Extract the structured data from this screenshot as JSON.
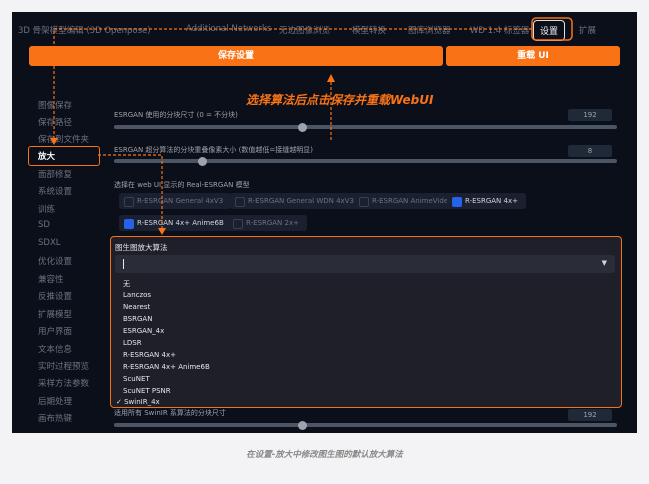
{
  "tabs": [
    "3D 骨架模型编辑 (3D Openpose)",
    "Additional Networks",
    "无边图像浏览",
    "模型转换",
    "图库浏览器",
    "WD 1.4 标签器",
    "设置",
    "扩展"
  ],
  "active_tab": "设置",
  "buttons": {
    "save": "保存设置",
    "reload": "重载 UI"
  },
  "sidebar": [
    "图像保存",
    "保存路径",
    "保存到文件夹",
    "放大",
    "面部修复",
    "系统设置",
    "训练",
    "SD",
    "SDXL",
    "优化设置",
    "兼容性",
    "反推设置",
    "扩展模型",
    "用户界面",
    "文本信息",
    "实时过程预览",
    "采样方法参数",
    "后期处理",
    "画布热键"
  ],
  "sidebar_active": "放大",
  "settings": {
    "esrgan_tile_label": "ESRGAN 使用的分块尺寸 (0 = 不分块)",
    "esrgan_tile_value": "192",
    "esrgan_overlap_label": "ESRGAN 超分算法的分块重叠像素大小 (数值越低=接缝越明显)",
    "esrgan_overlap_value": "8",
    "realesrgan_label": "选择在 web UI 显示的 Real-ESRGAN 模型",
    "realesrgan_models": [
      {
        "label": "R-ESRGAN General 4xV3",
        "checked": false
      },
      {
        "label": "R-ESRGAN General WDN 4xV3",
        "checked": false
      },
      {
        "label": "R-ESRGAN AnimeVideo",
        "checked": false
      },
      {
        "label": "R-ESRGAN 4x+",
        "checked": true
      },
      {
        "label": "R-ESRGAN 4x+ Anime6B",
        "checked": true
      },
      {
        "label": "R-ESRGAN 2x+",
        "checked": false
      }
    ],
    "swinir_tile_label": "适用所有 SwinIR 系算法的分块尺寸",
    "swinir_tile_value": "192"
  },
  "dropdown": {
    "title": "图生图放大算法",
    "options": [
      "无",
      "Lanczos",
      "Nearest",
      "BSRGAN",
      "ESRGAN_4x",
      "LDSR",
      "R-ESRGAN 4x+",
      "R-ESRGAN 4x+ Anime6B",
      "ScuNET",
      "ScuNET PSNR",
      "SwinIR_4x"
    ],
    "selected": "SwinIR_4x",
    "check_mark": "✓"
  },
  "annotation": "选择算法后点击保存并重载WebUI",
  "caption": "在设置-放大中修改图生图的默认放大算法",
  "colors": {
    "accent": "#f97316",
    "background": "#0b0f19",
    "checkbox": "#2563eb"
  }
}
